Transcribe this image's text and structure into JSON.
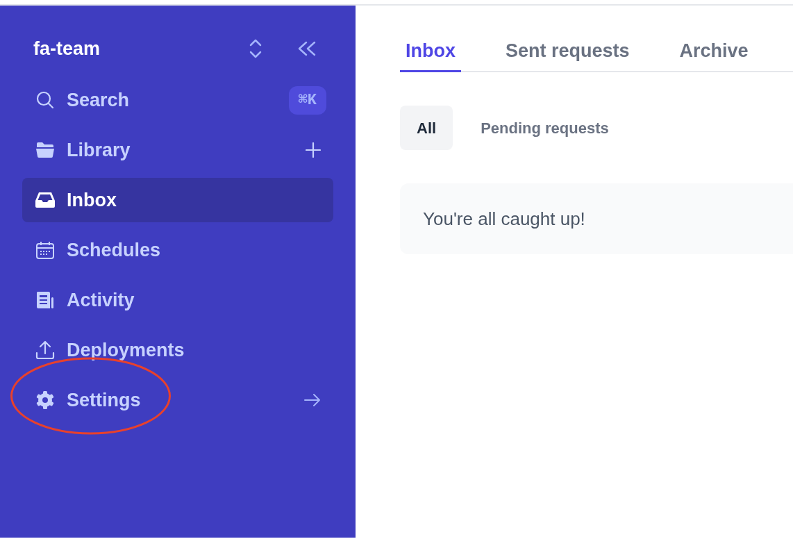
{
  "sidebar": {
    "team": "fa-team",
    "items": [
      {
        "label": "Search",
        "shortcut": "⌘K",
        "selected": false
      },
      {
        "label": "Library",
        "selected": false
      },
      {
        "label": "Inbox",
        "selected": true
      },
      {
        "label": "Schedules",
        "selected": false
      },
      {
        "label": "Activity",
        "selected": false
      },
      {
        "label": "Deployments",
        "selected": false
      },
      {
        "label": "Settings",
        "selected": false
      }
    ]
  },
  "tabs": [
    {
      "label": "Inbox",
      "selected": true
    },
    {
      "label": "Sent requests",
      "selected": false
    },
    {
      "label": "Archive",
      "selected": false
    }
  ],
  "filters": [
    {
      "label": "All",
      "selected": true
    },
    {
      "label": "Pending requests",
      "selected": false
    }
  ],
  "empty_message": "You're all caught up!"
}
